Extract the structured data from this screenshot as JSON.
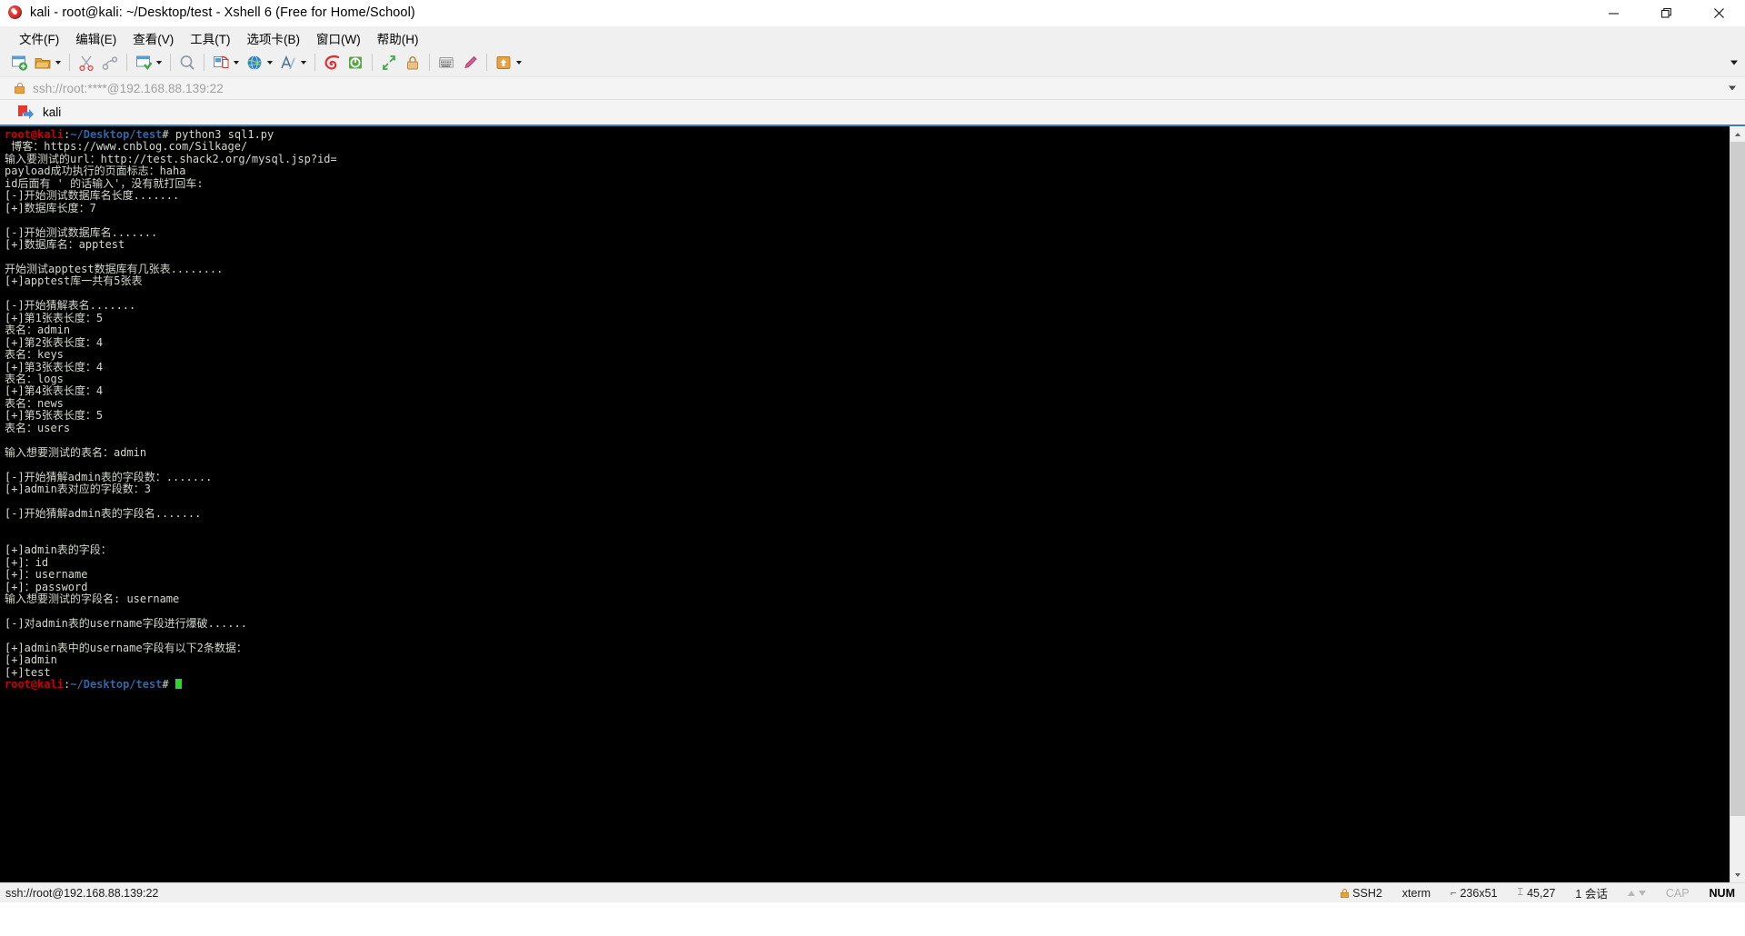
{
  "window": {
    "title": "kali - root@kali: ~/Desktop/test - Xshell 6 (Free for Home/School)",
    "minimize_label": "minimize",
    "maximize_label": "maximize",
    "close_label": "close"
  },
  "menubar": {
    "items": [
      {
        "label": "文件(F)",
        "name": "menu-file"
      },
      {
        "label": "编辑(E)",
        "name": "menu-edit"
      },
      {
        "label": "查看(V)",
        "name": "menu-view"
      },
      {
        "label": "工具(T)",
        "name": "menu-tools"
      },
      {
        "label": "选项卡(B)",
        "name": "menu-tabs"
      },
      {
        "label": "窗口(W)",
        "name": "menu-window"
      },
      {
        "label": "帮助(H)",
        "name": "menu-help"
      }
    ]
  },
  "toolbar": {
    "items": [
      {
        "icon": "new-session-icon"
      },
      {
        "icon": "open-folder-icon",
        "caret": true
      },
      {
        "sep": true
      },
      {
        "icon": "cut-scissors-icon"
      },
      {
        "icon": "copy-paste-icon"
      },
      {
        "sep": true
      },
      {
        "icon": "save-session-icon",
        "caret": true
      },
      {
        "sep": true
      },
      {
        "icon": "find-magnifier-icon"
      },
      {
        "sep": true
      },
      {
        "icon": "transfer-file-icon",
        "caret": true
      },
      {
        "icon": "globe-browser-icon",
        "caret": true
      },
      {
        "icon": "font-size-icon",
        "caret": true
      },
      {
        "sep": true
      },
      {
        "icon": "xshell-red-icon"
      },
      {
        "icon": "xftp-green-icon"
      },
      {
        "sep": true
      },
      {
        "icon": "fullscreen-arrows-icon"
      },
      {
        "icon": "lock-session-icon"
      },
      {
        "sep": true
      },
      {
        "icon": "keyboard-icon"
      },
      {
        "icon": "highlight-pen-icon"
      },
      {
        "sep": true
      },
      {
        "icon": "properties-icon",
        "caret": true
      }
    ],
    "overflow_label": "more toolbar buttons"
  },
  "address": {
    "value": "ssh://root:****@192.168.88.139:22",
    "icon": "lock-icon",
    "dropdown": "address-history-dropdown"
  },
  "tabs": [
    {
      "label": "kali",
      "icon": "session-tab-icon",
      "active": true
    }
  ],
  "terminal": {
    "lines": [
      {
        "segments": [
          {
            "t": "root@kali",
            "c": "t-red"
          },
          {
            "t": ":",
            "c": "t-white"
          },
          {
            "t": "~/Desktop/test",
            "c": "t-blue"
          },
          {
            "t": "# python3 sql1.py",
            "c": "t-white"
          }
        ]
      },
      {
        "segments": [
          {
            "t": " 博客：https://www.cnblog.com/Silkage/",
            "c": "t-white"
          }
        ]
      },
      {
        "segments": [
          {
            "t": "输入要测试的url：http://test.shack2.org/mysql.jsp?id=",
            "c": "t-white"
          }
        ]
      },
      {
        "segments": [
          {
            "t": "payload成功执行的页面标志：haha",
            "c": "t-white"
          }
        ]
      },
      {
        "segments": [
          {
            "t": "id后面有 ' 的话输入'，没有就打回车:",
            "c": "t-white"
          }
        ]
      },
      {
        "segments": [
          {
            "t": "[-]开始测试数据库名长度.......",
            "c": "t-white"
          }
        ]
      },
      {
        "segments": [
          {
            "t": "[+]数据库长度：7",
            "c": "t-white"
          }
        ]
      },
      {
        "segments": [
          {
            "t": "",
            "c": "t-white"
          }
        ]
      },
      {
        "segments": [
          {
            "t": "[-]开始测试数据库名.......",
            "c": "t-white"
          }
        ]
      },
      {
        "segments": [
          {
            "t": "[+]数据库名：apptest",
            "c": "t-white"
          }
        ]
      },
      {
        "segments": [
          {
            "t": "",
            "c": "t-white"
          }
        ]
      },
      {
        "segments": [
          {
            "t": "开始测试apptest数据库有几张表........",
            "c": "t-white"
          }
        ]
      },
      {
        "segments": [
          {
            "t": "[+]apptest库一共有5张表",
            "c": "t-white"
          }
        ]
      },
      {
        "segments": [
          {
            "t": "",
            "c": "t-white"
          }
        ]
      },
      {
        "segments": [
          {
            "t": "[-]开始猜解表名.......",
            "c": "t-white"
          }
        ]
      },
      {
        "segments": [
          {
            "t": "[+]第1张表长度：5",
            "c": "t-white"
          }
        ]
      },
      {
        "segments": [
          {
            "t": "表名：admin",
            "c": "t-white"
          }
        ]
      },
      {
        "segments": [
          {
            "t": "[+]第2张表长度：4",
            "c": "t-white"
          }
        ]
      },
      {
        "segments": [
          {
            "t": "表名：keys",
            "c": "t-white"
          }
        ]
      },
      {
        "segments": [
          {
            "t": "[+]第3张表长度：4",
            "c": "t-white"
          }
        ]
      },
      {
        "segments": [
          {
            "t": "表名：logs",
            "c": "t-white"
          }
        ]
      },
      {
        "segments": [
          {
            "t": "[+]第4张表长度：4",
            "c": "t-white"
          }
        ]
      },
      {
        "segments": [
          {
            "t": "表名：news",
            "c": "t-white"
          }
        ]
      },
      {
        "segments": [
          {
            "t": "[+]第5张表长度：5",
            "c": "t-white"
          }
        ]
      },
      {
        "segments": [
          {
            "t": "表名：users",
            "c": "t-white"
          }
        ]
      },
      {
        "segments": [
          {
            "t": "",
            "c": "t-white"
          }
        ]
      },
      {
        "segments": [
          {
            "t": "输入想要测试的表名：admin",
            "c": "t-white"
          }
        ]
      },
      {
        "segments": [
          {
            "t": "",
            "c": "t-white"
          }
        ]
      },
      {
        "segments": [
          {
            "t": "[-]开始猜解admin表的字段数：.......",
            "c": "t-white"
          }
        ]
      },
      {
        "segments": [
          {
            "t": "[+]admin表对应的字段数：3",
            "c": "t-white"
          }
        ]
      },
      {
        "segments": [
          {
            "t": "",
            "c": "t-white"
          }
        ]
      },
      {
        "segments": [
          {
            "t": "[-]开始猜解admin表的字段名.......",
            "c": "t-white"
          }
        ]
      },
      {
        "segments": [
          {
            "t": "",
            "c": "t-white"
          }
        ]
      },
      {
        "segments": [
          {
            "t": "",
            "c": "t-white"
          }
        ]
      },
      {
        "segments": [
          {
            "t": "[+]admin表的字段：",
            "c": "t-white"
          }
        ]
      },
      {
        "segments": [
          {
            "t": "[+]：id",
            "c": "t-white"
          }
        ]
      },
      {
        "segments": [
          {
            "t": "[+]：username",
            "c": "t-white"
          }
        ]
      },
      {
        "segments": [
          {
            "t": "[+]：password",
            "c": "t-white"
          }
        ]
      },
      {
        "segments": [
          {
            "t": "输入想要测试的字段名: username",
            "c": "t-white"
          }
        ]
      },
      {
        "segments": [
          {
            "t": "",
            "c": "t-white"
          }
        ]
      },
      {
        "segments": [
          {
            "t": "[-]对admin表的username字段进行爆破......",
            "c": "t-white"
          }
        ]
      },
      {
        "segments": [
          {
            "t": "",
            "c": "t-white"
          }
        ]
      },
      {
        "segments": [
          {
            "t": "[+]admin表中的username字段有以下2条数据：",
            "c": "t-white"
          }
        ]
      },
      {
        "segments": [
          {
            "t": "[+]admin",
            "c": "t-white"
          }
        ]
      },
      {
        "segments": [
          {
            "t": "[+]test",
            "c": "t-white"
          }
        ]
      },
      {
        "segments": [
          {
            "t": "root@kali",
            "c": "t-red"
          },
          {
            "t": ":",
            "c": "t-white"
          },
          {
            "t": "~/Desktop/test",
            "c": "t-blue"
          },
          {
            "t": "# ",
            "c": "t-white"
          },
          {
            "t": "",
            "c": "cursor"
          }
        ]
      }
    ],
    "background": "#000000",
    "foreground": "#d3d7cf",
    "prompt_user_color": "#cc0000",
    "prompt_path_color": "#3465a4",
    "cursor_color": "#2fd42f"
  },
  "statusbar": {
    "connection": "ssh://root@192.168.88.139:22",
    "protocol": "SSH2",
    "terminal_type": "xterm",
    "size": "236x51",
    "cursor_position": "45,27",
    "sessions": "1 会话",
    "cap": "CAP",
    "num": "NUM"
  }
}
